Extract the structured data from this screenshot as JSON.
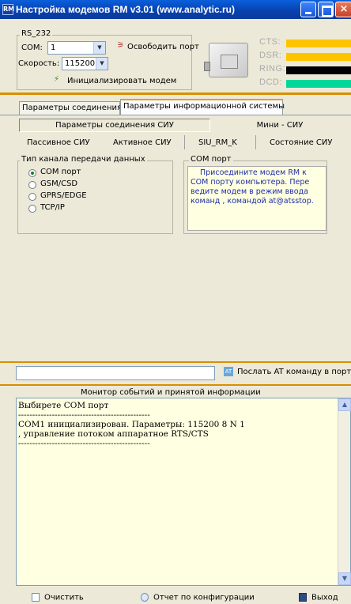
{
  "window": {
    "title": "Настройка модемов RM v3.01 (www.analytic.ru)",
    "close_glyph": "×"
  },
  "rs232": {
    "legend": "RS_232",
    "com_label": "COM:",
    "com_value": "1",
    "speed_label": "Скорость:",
    "speed_value": "115200",
    "free_port_label": "Освободить порт",
    "init_label": "Инициализировать модем"
  },
  "signals": [
    {
      "label": "CTS:",
      "color": "#ffc400"
    },
    {
      "label": "DSR:",
      "color": "#ffc400"
    },
    {
      "label": "RING:",
      "color": "#000000"
    },
    {
      "label": "DCD:",
      "color": "#00d79a"
    }
  ],
  "tabs": [
    "Параметры соединения",
    "Параметры информационной системы"
  ],
  "subtabs": {
    "siu_params": "Параметры соединения СИУ",
    "mini_siu": "Мини - СИУ"
  },
  "subrow": [
    "Пассивное СИУ",
    "Активное СИУ",
    "SIU_RM_K",
    "Состояние СИУ"
  ],
  "channel": {
    "legend": "Тип канала передачи данных",
    "options": [
      "COM порт",
      "GSM/CSD",
      "GPRS/EDGE",
      "TCP/IP"
    ],
    "selected": 0
  },
  "com_port": {
    "legend": "COM порт",
    "note_lines": [
      "Присоедините модем RM к",
      "COM порту компьютера. Пере",
      "ведите модем в режим  ввода",
      "команд , командой at@atsstop."
    ]
  },
  "at": {
    "input_value": "",
    "send_label": "Послать AT команду в порт"
  },
  "monitor": {
    "title": "Монитор событий и  принятой информации",
    "lines": [
      "Выбирете COM порт",
      "-----------------------------------------------",
      "COM1 инициализирован. Параметры: 115200 8 N 1",
      ", управление потоком аппаратное RTS/CTS",
      "-----------------------------------------------"
    ]
  },
  "footer": {
    "clear": "Очистить",
    "report": "Отчет по конфигурации",
    "exit": "Выход"
  }
}
